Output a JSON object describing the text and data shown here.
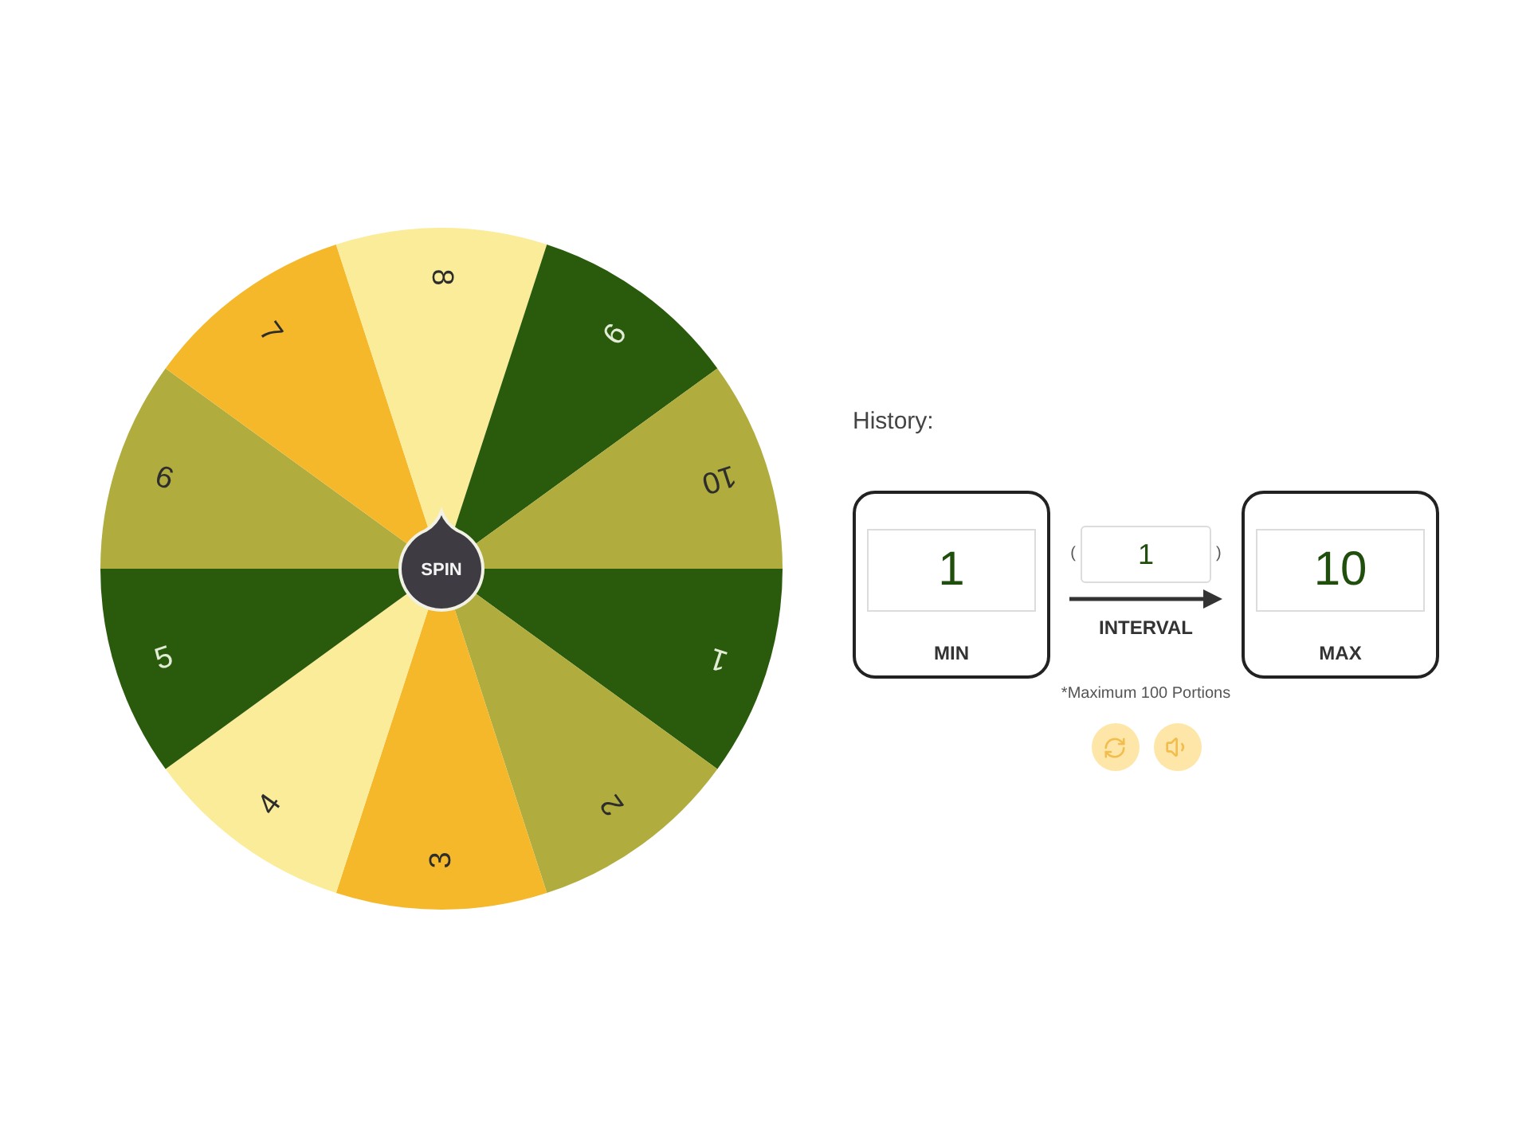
{
  "wheel": {
    "segments": [
      {
        "label": "1",
        "color": "#2a5a0c"
      },
      {
        "label": "2",
        "color": "#b0ac3d"
      },
      {
        "label": "3",
        "color": "#f5b82b"
      },
      {
        "label": "4",
        "color": "#fbec99"
      },
      {
        "label": "5",
        "color": "#2a5a0c"
      },
      {
        "label": "6",
        "color": "#b0ac3d"
      },
      {
        "label": "7",
        "color": "#f5b82b"
      },
      {
        "label": "8",
        "color": "#fbec99"
      },
      {
        "label": "9",
        "color": "#2a5a0c"
      },
      {
        "label": "10",
        "color": "#b0ac3d"
      }
    ],
    "spin_button": "SPIN"
  },
  "history": {
    "label": "History:"
  },
  "range": {
    "min": {
      "value": "1",
      "label": "MIN"
    },
    "interval": {
      "open": "(",
      "value": "1",
      "close": ")",
      "label": "INTERVAL"
    },
    "max": {
      "value": "10",
      "label": "MAX"
    },
    "note": "*Maximum 100 Portions"
  }
}
